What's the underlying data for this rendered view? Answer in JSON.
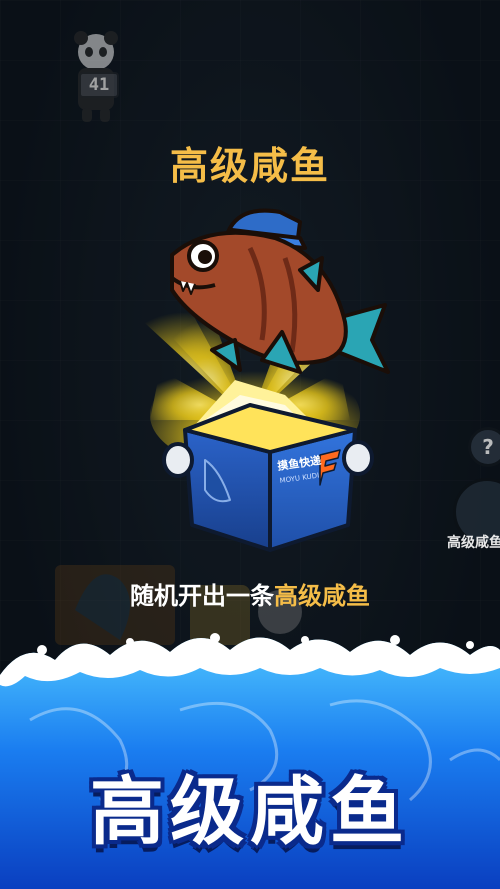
{
  "player": {
    "level": "41"
  },
  "reward": {
    "title": "高级咸鱼",
    "desc_prefix": "随机开出一条",
    "desc_highlight": "高级咸鱼"
  },
  "box": {
    "brand_cn": "摸鱼快递",
    "brand_en": "MOYU KUDI"
  },
  "side": {
    "help_icon": "?",
    "fish_button_label": "高级咸鱼"
  },
  "banner": {
    "title": "高级咸鱼"
  },
  "colors": {
    "title_gold": "#f5bd48",
    "box_blue": "#2b63c9",
    "ocean_blue": "#1a7df0",
    "banner_outline": "#0a2a8c"
  }
}
